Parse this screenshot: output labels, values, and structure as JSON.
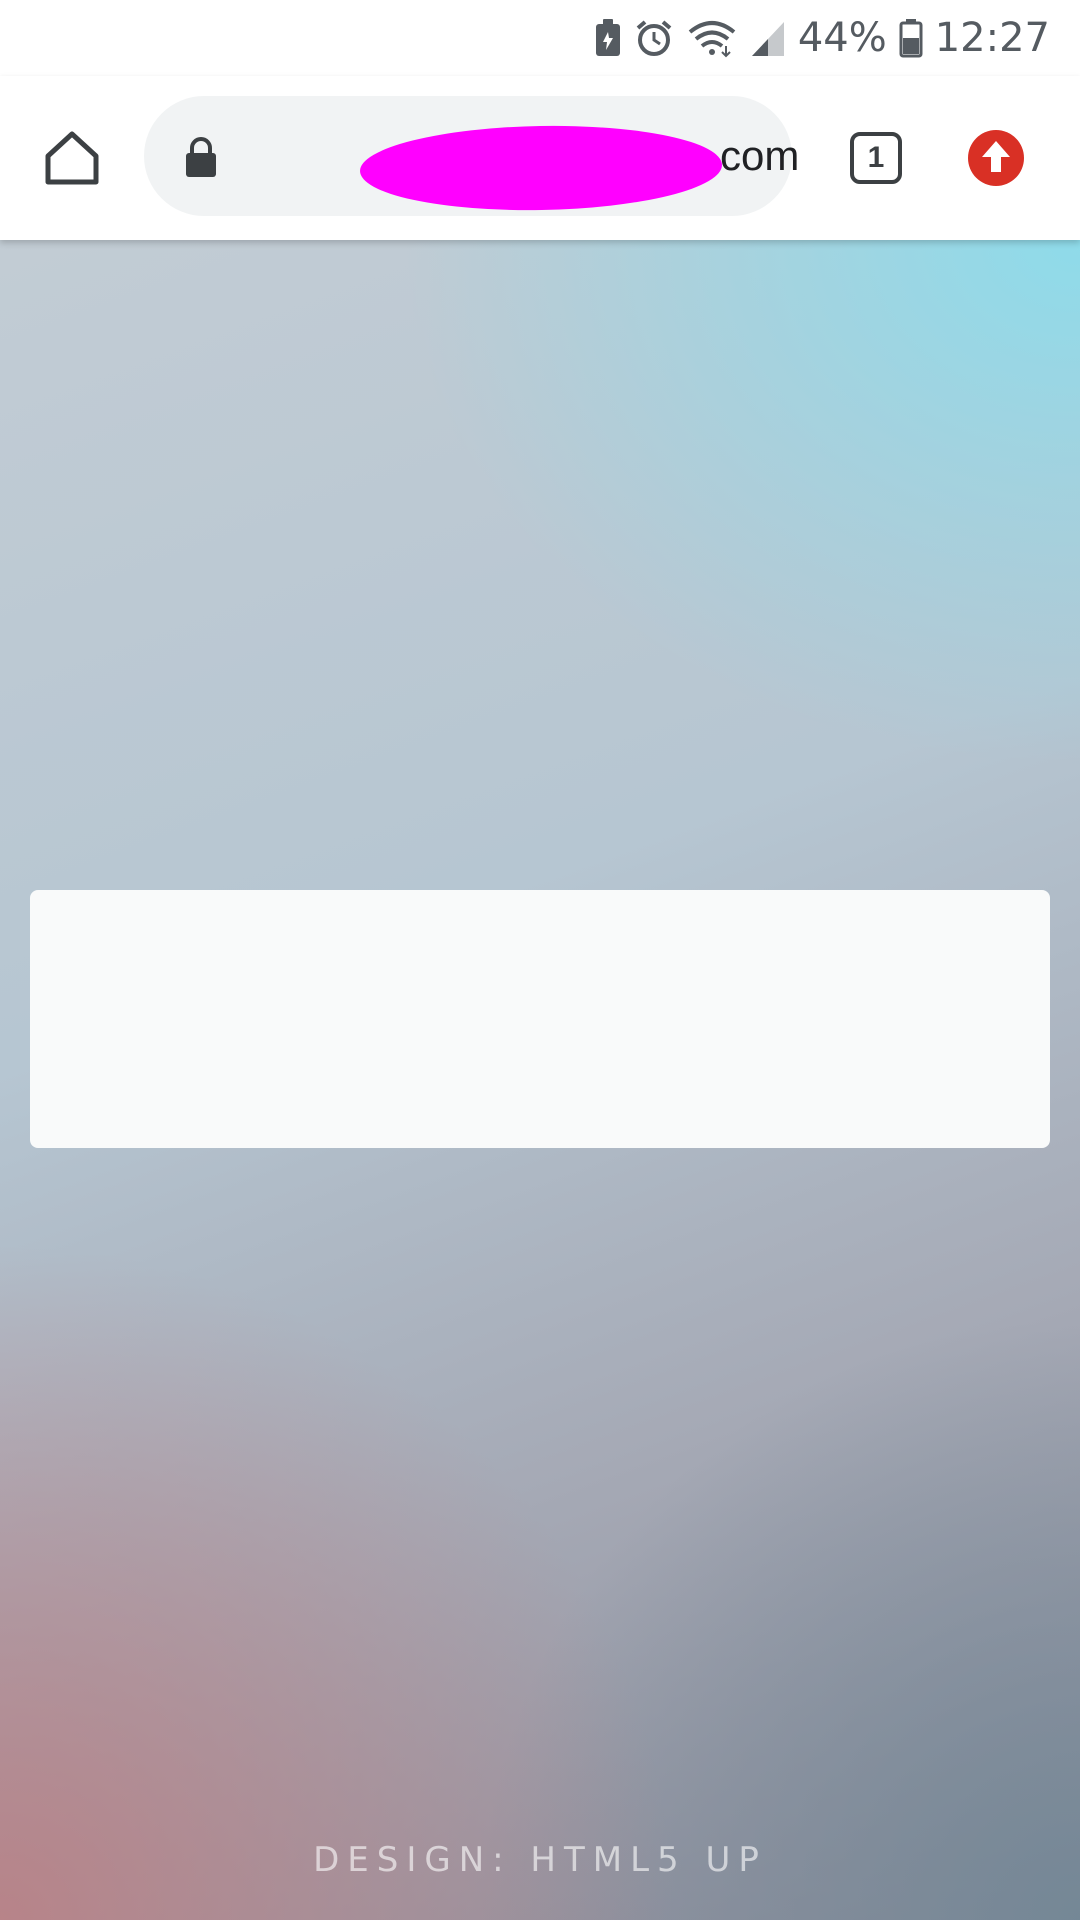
{
  "status_bar": {
    "battery_percent": "44%",
    "time": "12:27",
    "icons": [
      "battery-saver-icon",
      "alarm-icon",
      "wifi-icon",
      "signal-icon",
      "battery-icon"
    ]
  },
  "toolbar": {
    "url_suffix": "com",
    "tab_count": "1",
    "icons": [
      "home-icon",
      "lock-icon",
      "tabs-icon",
      "update-icon"
    ],
    "accent_color": "#d93025"
  },
  "page": {
    "footer_credit": "DESIGN: HTML5 UP"
  }
}
